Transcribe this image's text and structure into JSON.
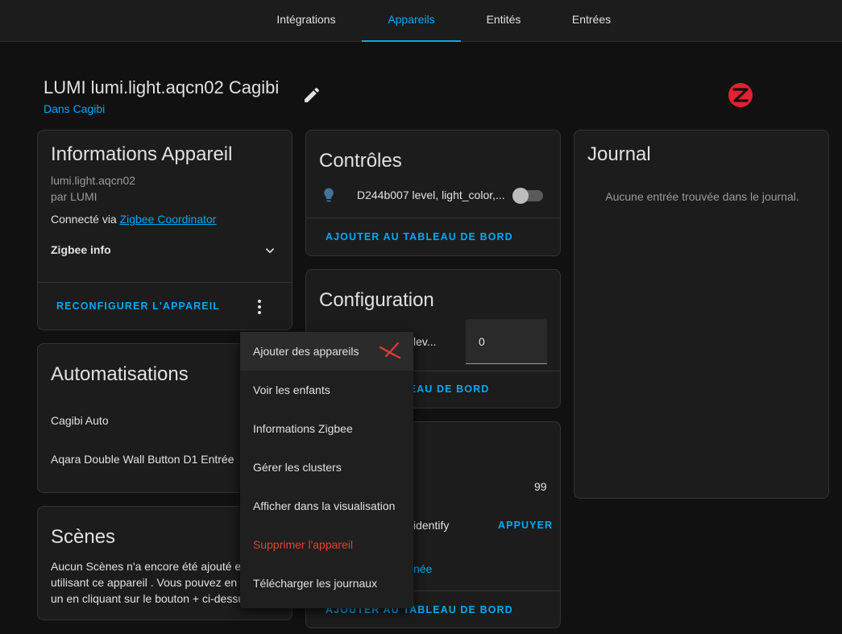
{
  "tabs": [
    {
      "label": "Intégrations"
    },
    {
      "label": "Appareils"
    },
    {
      "label": "Entités"
    },
    {
      "label": "Entrées"
    }
  ],
  "device": {
    "title": "LUMI lumi.light.aqcn02 Cagibi",
    "area": "Dans Cagibi",
    "brand": "zigbee"
  },
  "info_card": {
    "title": "Informations Appareil",
    "model": "lumi.light.aqcn02",
    "manufacturer": "par LUMI",
    "connected_prefix": "Connecté via ",
    "connected_link": "Zigbee Coordinator",
    "zigbee_info": "Zigbee info",
    "reconfigure": "RECONFIGURER L'APPAREIL"
  },
  "controls_card": {
    "title": "Contrôles",
    "entity_label": "D244b007 level, light_color,...",
    "toggle_on": false,
    "add_dashboard": "AJOUTER AU TABLEAU DE BORD"
  },
  "config_card": {
    "title": "Configuration",
    "row_label_partial": "lev...",
    "value": "0",
    "add_dashboard_partial": "LEAU DE BORD"
  },
  "diag_card": {
    "value": "99",
    "identify_partial": "identify",
    "press": "APPUYER",
    "partial_link": "née",
    "add_dashboard": "AJOUTER AU TABLEAU DE BORD"
  },
  "journal_card": {
    "title": "Journal",
    "empty": "Aucune entrée trouvée dans le journal."
  },
  "automations_card": {
    "title": "Automatisations",
    "items": [
      {
        "label": "Cagibi Auto"
      },
      {
        "label": "Aqara Double Wall Button D1 Entrée"
      }
    ]
  },
  "scenes_card": {
    "title": "Scènes",
    "lines": [
      "Aucun Scènes n'a encore été ajouté en",
      "utilisant ce appareil . Vous pouvez en a",
      "un en cliquant sur le bouton + ci-dessu"
    ]
  },
  "menu": {
    "items": [
      {
        "label": "Ajouter des appareils"
      },
      {
        "label": "Voir les enfants"
      },
      {
        "label": "Informations Zigbee"
      },
      {
        "label": "Gérer les clusters"
      },
      {
        "label": "Afficher dans la visualisation"
      },
      {
        "label": "Supprimer l'appareil"
      },
      {
        "label": "Télécharger les journaux"
      }
    ]
  },
  "colors": {
    "accent": "#03a9f4",
    "danger": "#db4437",
    "brand_red": "#e2222e",
    "annotation_red": "#e53935"
  },
  "icons": [
    "pencil-icon",
    "zigbee-logo",
    "chevron-down-icon",
    "more-vertical-icon",
    "lightbulb-icon"
  ]
}
